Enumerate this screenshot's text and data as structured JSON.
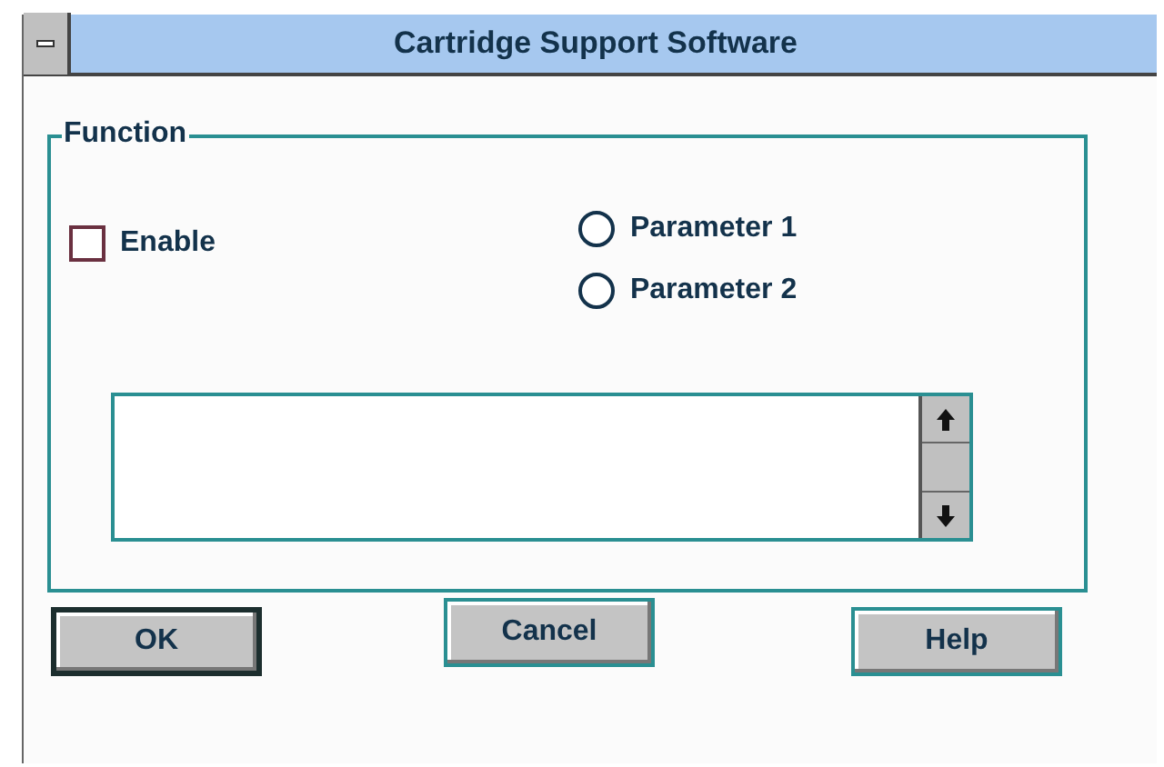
{
  "window": {
    "title": "Cartridge Support Software"
  },
  "group": {
    "title": "Function"
  },
  "checkbox": {
    "label": "Enable",
    "checked": false
  },
  "radios": [
    {
      "label": "Parameter 1",
      "selected": false
    },
    {
      "label": "Parameter 2",
      "selected": false
    }
  ],
  "buttons": [
    {
      "label": "OK",
      "default": true
    },
    {
      "label": "Cancel",
      "default": false
    },
    {
      "label": "Help",
      "default": false
    }
  ]
}
